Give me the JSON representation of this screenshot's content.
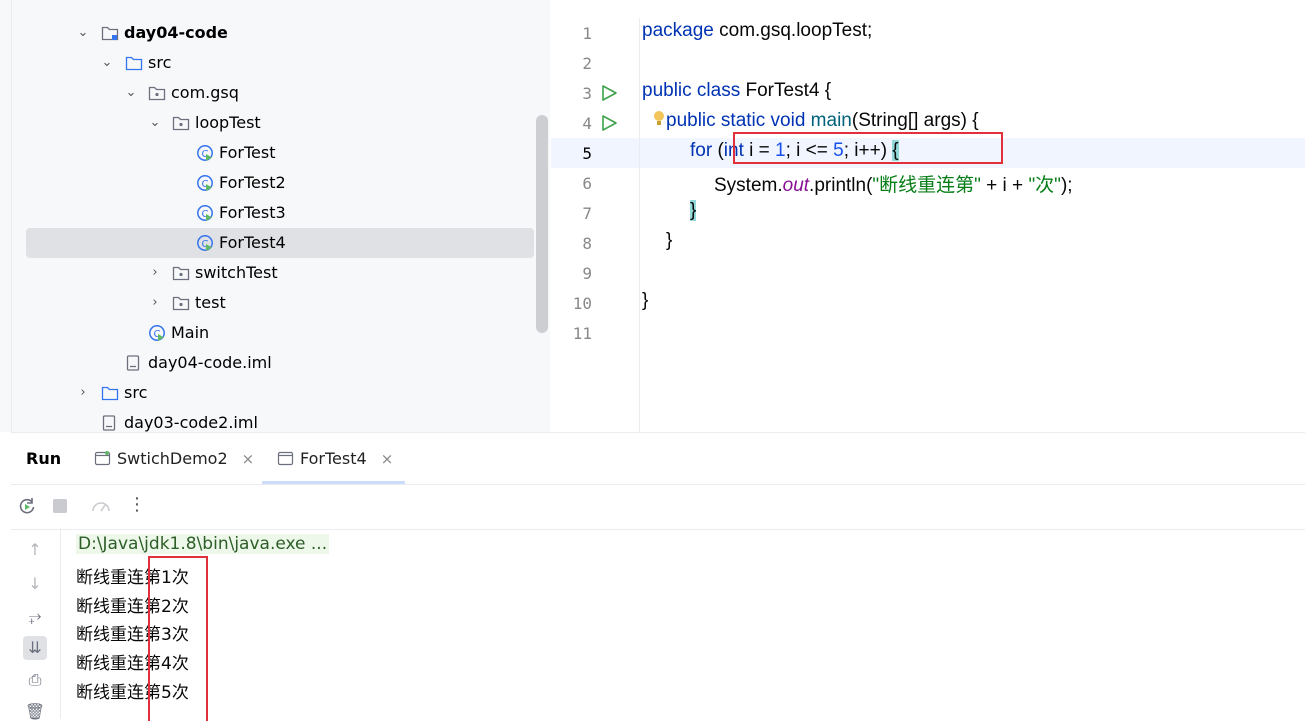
{
  "project_tree": {
    "items": [
      {
        "label": "day04-code",
        "bold": true
      },
      {
        "label": "src"
      },
      {
        "label": "com.gsq"
      },
      {
        "label": "loopTest"
      },
      {
        "label": "ForTest"
      },
      {
        "label": "ForTest2"
      },
      {
        "label": "ForTest3"
      },
      {
        "label": "ForTest4"
      },
      {
        "label": "switchTest"
      },
      {
        "label": "test"
      },
      {
        "label": "Main"
      },
      {
        "label": "day04-code.iml"
      },
      {
        "label": "src"
      },
      {
        "label": "day03-code2.iml"
      }
    ]
  },
  "editor": {
    "line_numbers": [
      "1",
      "2",
      "3",
      "4",
      "5",
      "6",
      "7",
      "8",
      "9",
      "10",
      "11"
    ],
    "current_line": "5",
    "code": {
      "l1_kw": "package",
      "l1_rest": " com.gsq.loopTest;",
      "l3_kw": "public class",
      "l3_rest": " ForTest4 {",
      "l4_kw": "public static void",
      "l4_fn": " main",
      "l4_rest": "(String[] args) {",
      "l5_kw1": "for",
      "l5_p1": " (",
      "l5_kw2": "int",
      "l5_p2": " i = ",
      "l5_n1": "1",
      "l5_p3": "; i <= ",
      "l5_n2": "5",
      "l5_p4": "; i++) ",
      "l5_brace": "{",
      "l6_p1": "System.",
      "l6_fld": "out",
      "l6_p2": ".println(",
      "l6_s1": "\"断线重连第\"",
      "l6_p3": " + i + ",
      "l6_s2": "\"次\"",
      "l6_p4": ");",
      "l7": "}",
      "l8": "}",
      "l10": "}"
    }
  },
  "run_panel": {
    "title": "Run",
    "tabs": [
      {
        "label": "SwtichDemo2",
        "close": "×"
      },
      {
        "label": "ForTest4",
        "close": "×"
      }
    ],
    "output": {
      "command": "D:\\Java\\jdk1.8\\bin\\java.exe ...",
      "lines": [
        "断线重连第1次",
        "断线重连第2次",
        "断线重连第3次",
        "断线重连第4次",
        "断线重连第5次"
      ]
    }
  },
  "colors": {
    "keyword": "#0033b3",
    "number": "#1750eb",
    "string": "#067d17",
    "highlight_box": "#e0313b"
  },
  "icons": [
    "chevron-down-icon",
    "chevron-right-icon",
    "module-folder-icon",
    "folder-icon",
    "package-icon",
    "java-class-icon",
    "file-icon",
    "run-gutter-icon",
    "lightbulb-icon",
    "rerun-icon",
    "stop-icon",
    "profiler-icon",
    "more-icon",
    "up-icon",
    "down-icon",
    "soft-wrap-icon",
    "scroll-end-icon",
    "print-icon",
    "trash-icon"
  ]
}
